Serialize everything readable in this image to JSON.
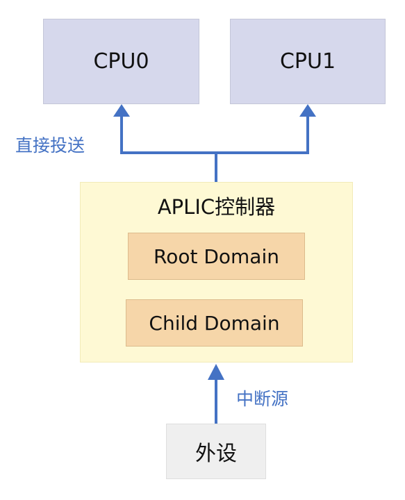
{
  "nodes": {
    "cpu0": "CPU0",
    "cpu1": "CPU1",
    "aplic_title": "APLIC控制器",
    "root_domain": "Root Domain",
    "child_domain": "Child Domain",
    "peripheral": "外设"
  },
  "edge_labels": {
    "direct_delivery": "直接投送",
    "interrupt_source": "中断源"
  },
  "colors": {
    "cpu_fill": "#d6d8ec",
    "aplic_fill": "#fef9d4",
    "domain_fill": "#f6d6a9",
    "peripheral_fill": "#efefef",
    "arrow": "#4472c4",
    "label": "#4472c4"
  }
}
